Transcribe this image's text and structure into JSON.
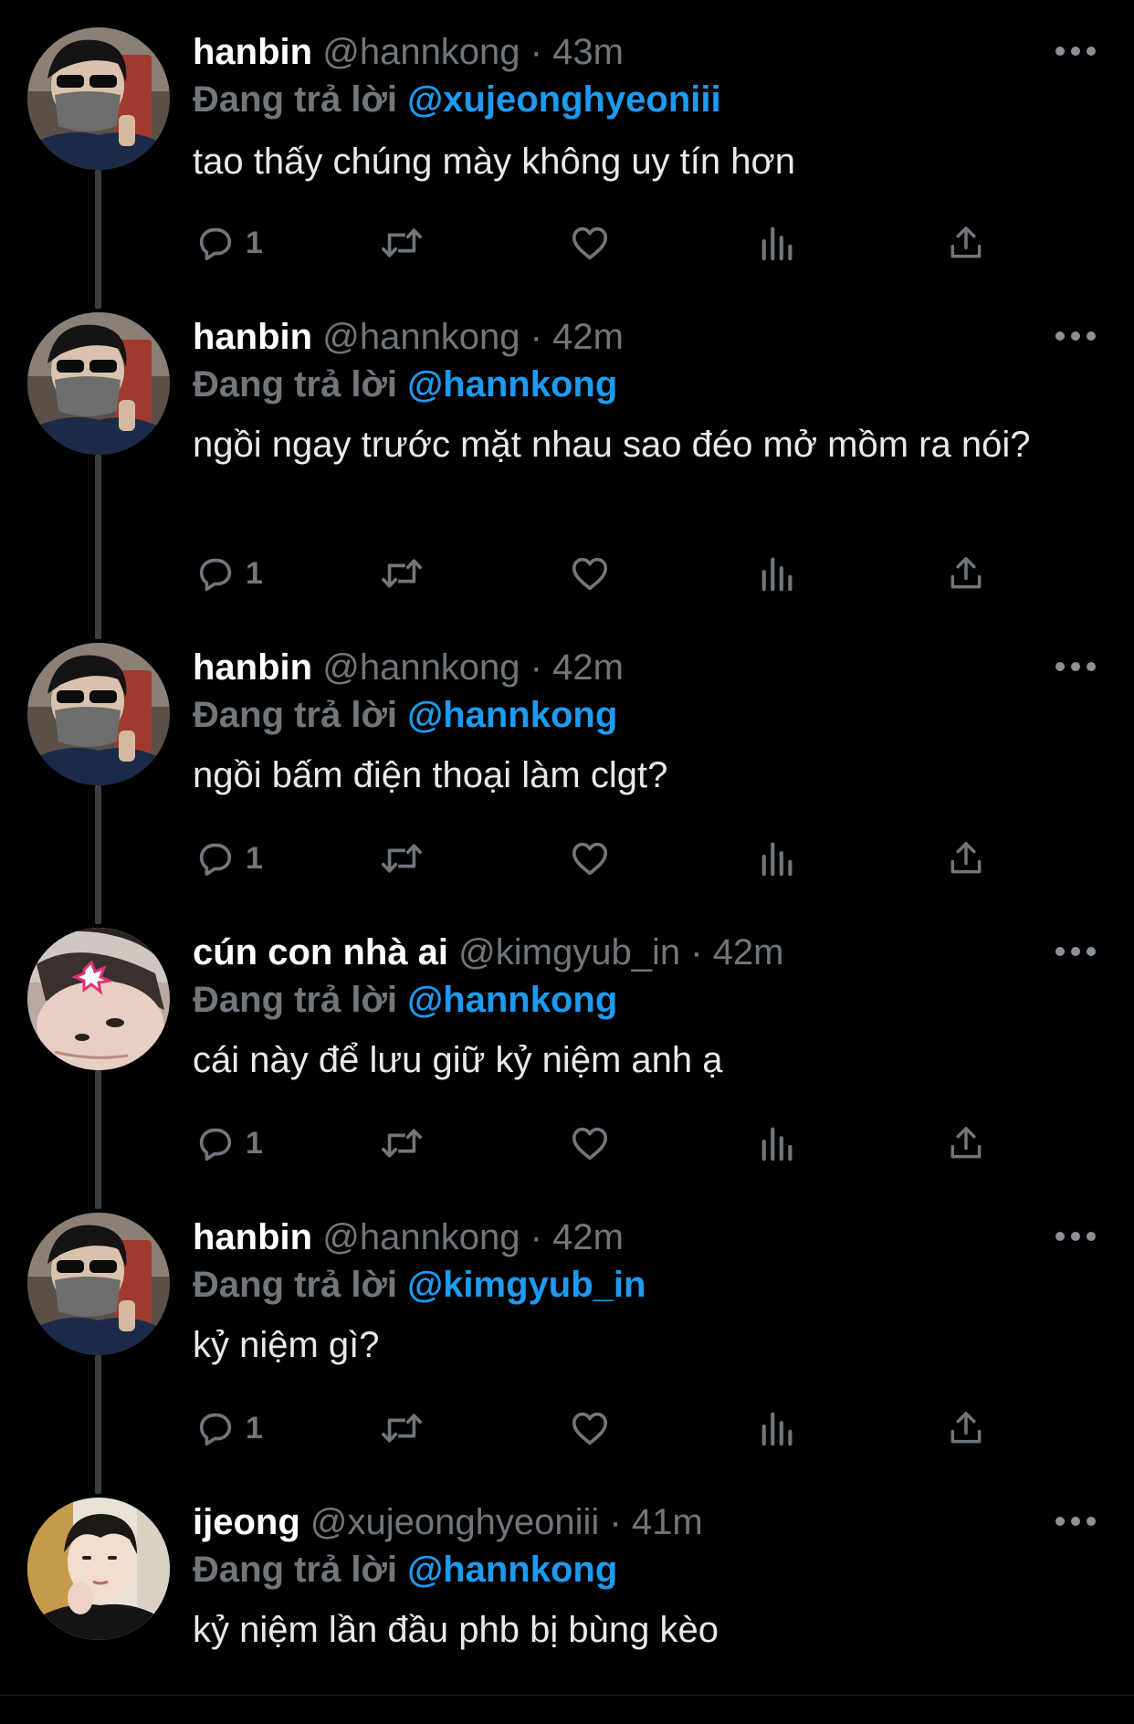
{
  "theme": {
    "background": "#000000",
    "text": "#e7e9ea",
    "muted": "#71767b",
    "accent": "#1d9bf0"
  },
  "tweets": [
    {
      "name": "hanbin",
      "handle": "@hannkong",
      "separator": "·",
      "time": "43m",
      "reply_prefix": "Đang trả lời",
      "reply_to": "@xujeonghyeoniii",
      "text": "tao thấy chúng mày không uy tín hơn",
      "reply_count": "1",
      "avatar": "hanbin-avatar"
    },
    {
      "name": "hanbin",
      "handle": "@hannkong",
      "separator": "·",
      "time": "42m",
      "reply_prefix": "Đang trả lời",
      "reply_to": "@hannkong",
      "text": "ngồi ngay trước mặt nhau sao đéo mở mồm ra nói?",
      "reply_count": "1",
      "avatar": "hanbin-avatar"
    },
    {
      "name": "hanbin",
      "handle": "@hannkong",
      "separator": "·",
      "time": "42m",
      "reply_prefix": "Đang trả lời",
      "reply_to": "@hannkong",
      "text": "ngồi bấm điện thoại làm clgt?",
      "reply_count": "1",
      "avatar": "hanbin-avatar"
    },
    {
      "name": "cún con nhà ai",
      "handle": "@kimgyub_in",
      "separator": "·",
      "time": "42m",
      "reply_prefix": "Đang trả lời",
      "reply_to": "@hannkong",
      "text": "cái này để lưu giữ kỷ niệm anh ạ",
      "reply_count": "1",
      "avatar": "kimgyub-avatar"
    },
    {
      "name": "hanbin",
      "handle": "@hannkong",
      "separator": "·",
      "time": "42m",
      "reply_prefix": "Đang trả lời",
      "reply_to": "@kimgyub_in",
      "text": "kỷ niệm gì?",
      "reply_count": "1",
      "avatar": "hanbin-avatar"
    },
    {
      "name": "ijeong",
      "handle": "@xujeonghyeoniii",
      "separator": "·",
      "time": "41m",
      "reply_prefix": "Đang trả lời",
      "reply_to": "@hannkong",
      "text": "kỷ niệm lần đầu phb bị bùng kèo",
      "avatar": "ijeong-avatar"
    }
  ],
  "icons": {
    "reply": "reply-icon",
    "retweet": "retweet-icon",
    "like": "heart-icon",
    "views": "views-icon",
    "share": "share-icon",
    "more": "more-icon"
  }
}
